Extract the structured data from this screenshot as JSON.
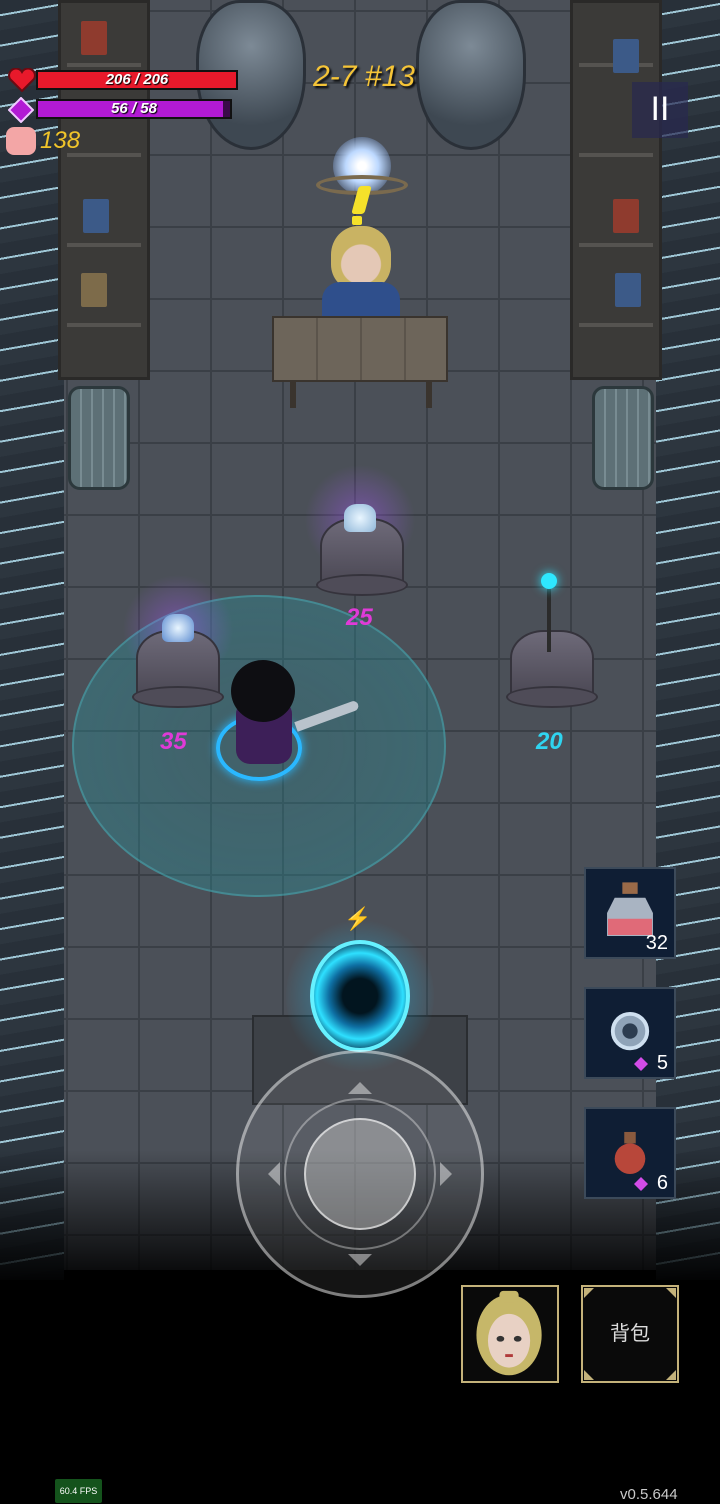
{
  "hud": {
    "hp_text": "206 / 206",
    "hp_current": 206,
    "hp_max": 206,
    "mp_text": "56 / 58",
    "mp_current": 56,
    "mp_max": 58,
    "gold": "138",
    "stage": "2-7 #13",
    "pause_symbol": "II"
  },
  "shop": {
    "prices": [
      {
        "name": "price-center",
        "value": "25",
        "color": "#e03ad8"
      },
      {
        "name": "price-left",
        "value": "35",
        "color": "#e03ad8"
      },
      {
        "name": "price-right",
        "value": "20",
        "color": "#2fd4f0"
      }
    ]
  },
  "items": [
    {
      "name": "health-potion",
      "count": "32",
      "cost_type": "none",
      "icon": "potion-bottle-icon"
    },
    {
      "name": "gear-orb",
      "count": "5",
      "cost_type": "gem",
      "icon": "gear-orb-icon"
    },
    {
      "name": "red-flask",
      "count": "6",
      "cost_type": "gem",
      "icon": "red-flask-icon"
    }
  ],
  "bottom": {
    "bag_label": "背包",
    "fps": "60.4 FPS",
    "version": "v0.5.644"
  },
  "colors": {
    "hp": "#e8192b",
    "mp": "#b21ad4",
    "gold": "#f0c42a",
    "accent_cyan": "#2ee0ff"
  }
}
